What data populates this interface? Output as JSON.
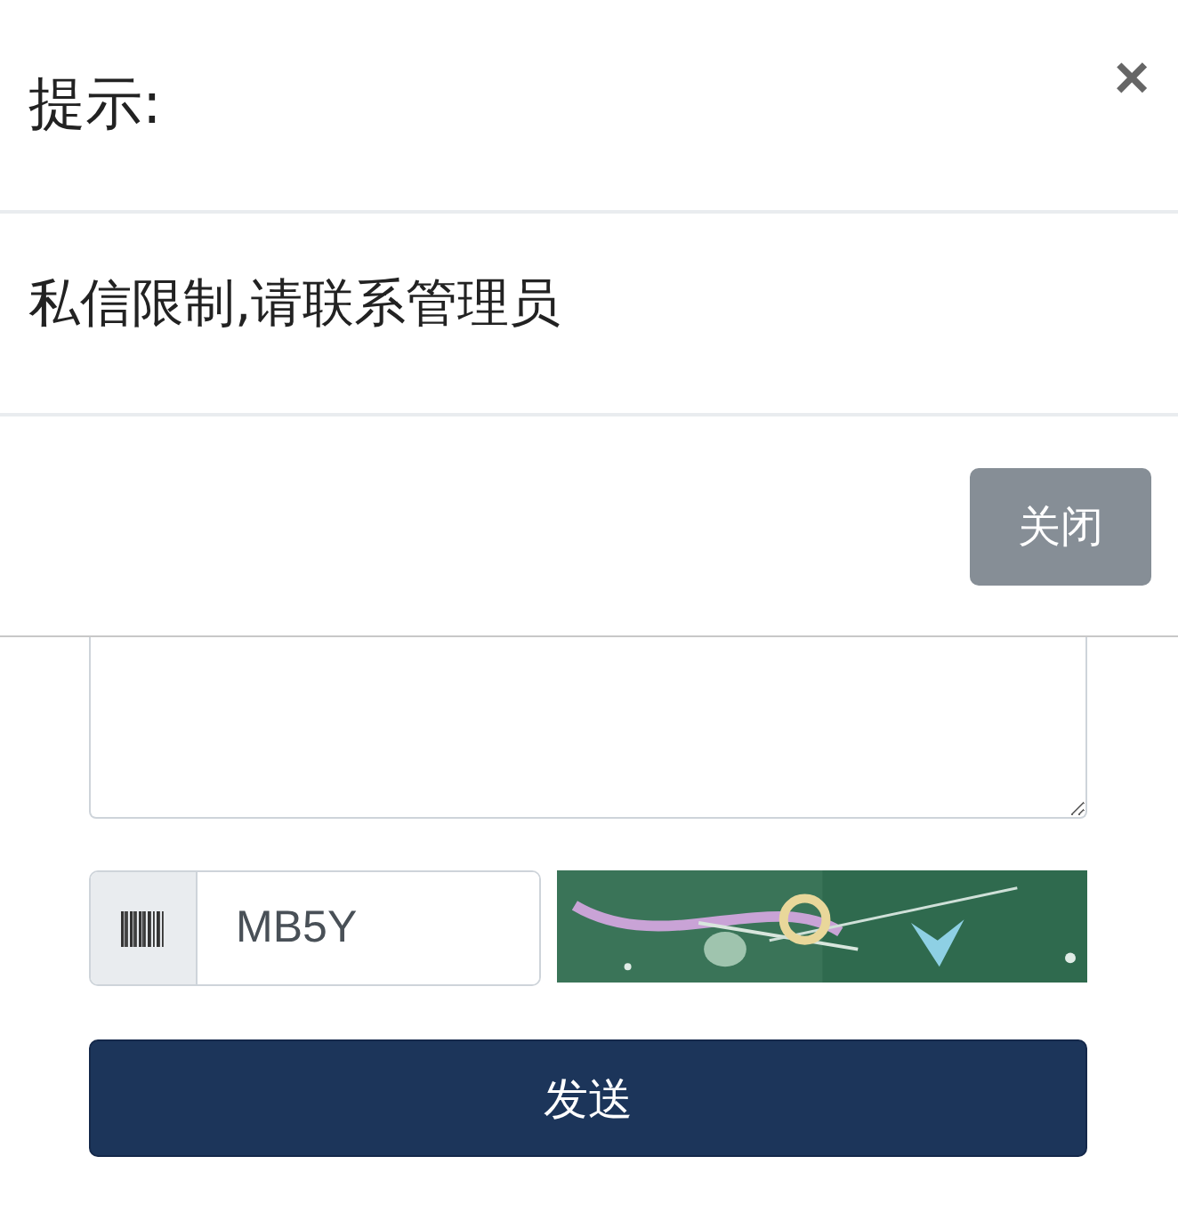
{
  "dialog": {
    "title": "提示:",
    "close": "×",
    "message": "私信限制,请联系管理员",
    "button": "关闭"
  },
  "form": {
    "captcha_input": {
      "value": "MB5Y"
    },
    "submit": "发送"
  }
}
